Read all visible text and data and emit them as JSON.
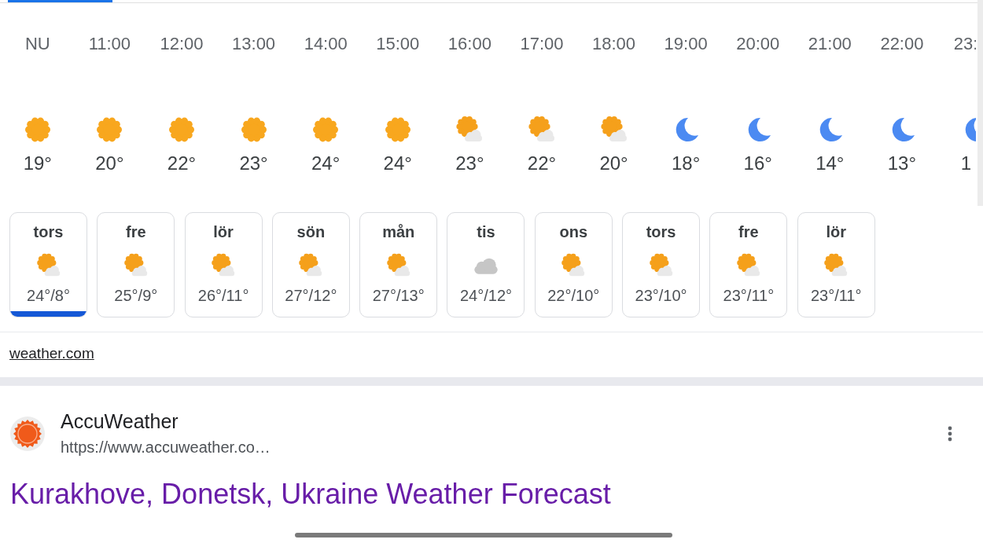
{
  "hourly": [
    {
      "time": "NU",
      "kind": "sun",
      "temp": "19°",
      "cut_off": false
    },
    {
      "time": "11:00",
      "kind": "sun",
      "temp": "20°",
      "cut_off": false
    },
    {
      "time": "12:00",
      "kind": "sun",
      "temp": "22°",
      "cut_off": false
    },
    {
      "time": "13:00",
      "kind": "sun",
      "temp": "23°",
      "cut_off": false
    },
    {
      "time": "14:00",
      "kind": "sun",
      "temp": "24°",
      "cut_off": false
    },
    {
      "time": "15:00",
      "kind": "sun",
      "temp": "24°",
      "cut_off": false
    },
    {
      "time": "16:00",
      "kind": "sun-cloud",
      "temp": "23°",
      "cut_off": false
    },
    {
      "time": "17:00",
      "kind": "sun-cloud",
      "temp": "22°",
      "cut_off": false
    },
    {
      "time": "18:00",
      "kind": "sun-cloud",
      "temp": "20°",
      "cut_off": false
    },
    {
      "time": "19:00",
      "kind": "moon",
      "temp": "18°",
      "cut_off": false
    },
    {
      "time": "20:00",
      "kind": "moon",
      "temp": "16°",
      "cut_off": false
    },
    {
      "time": "21:00",
      "kind": "moon",
      "temp": "14°",
      "cut_off": false
    },
    {
      "time": "22:00",
      "kind": "moon",
      "temp": "13°",
      "cut_off": false
    },
    {
      "time": "23:",
      "kind": "moon",
      "temp": "1",
      "cut_off": true
    }
  ],
  "days": [
    {
      "day": "tors",
      "kind": "sun-cloud",
      "temps": "24°/8°",
      "selected": true
    },
    {
      "day": "fre",
      "kind": "sun-cloud",
      "temps": "25°/9°",
      "selected": false
    },
    {
      "day": "lör",
      "kind": "sun-cloud",
      "temps": "26°/11°",
      "selected": false
    },
    {
      "day": "sön",
      "kind": "sun-cloud",
      "temps": "27°/12°",
      "selected": false
    },
    {
      "day": "mån",
      "kind": "sun-cloud",
      "temps": "27°/13°",
      "selected": false
    },
    {
      "day": "tis",
      "kind": "cloud",
      "temps": "24°/12°",
      "selected": false
    },
    {
      "day": "ons",
      "kind": "sun-cloud",
      "temps": "22°/10°",
      "selected": false
    },
    {
      "day": "tors",
      "kind": "sun-cloud",
      "temps": "23°/10°",
      "selected": false
    },
    {
      "day": "fre",
      "kind": "sun-cloud",
      "temps": "23°/11°",
      "selected": false
    },
    {
      "day": "lör",
      "kind": "sun-cloud",
      "temps": "23°/11°",
      "selected": false
    }
  ],
  "source_link": "weather.com",
  "result": {
    "site_name": "AccuWeather",
    "url": "https://www.accuweather.co…",
    "title": "Kurakhove, Donetsk, Ukraine Weather Forecast"
  }
}
